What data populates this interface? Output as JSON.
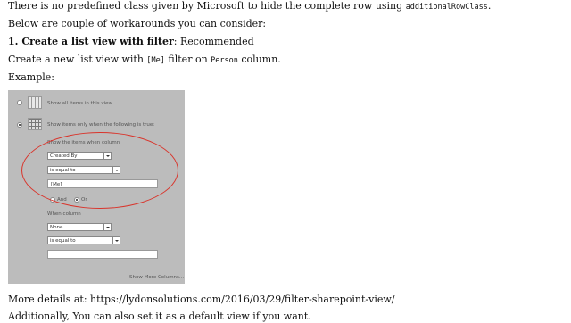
{
  "para1": {
    "text": "There is no predefined class given by Microsoft to hide the complete row using ",
    "code": "additionalRowClass",
    "end": "."
  },
  "para2": "Below are couple of workarounds you can consider:",
  "heading": {
    "bold": "1. Create a list view with filter",
    "rest": ": Recommended"
  },
  "para3": {
    "a": "Create a new list view with ",
    "code1": "[Me]",
    "b": " filter on ",
    "code2": "Person",
    "c": " column."
  },
  "example_label": "Example:",
  "screenshot": {
    "option_all": "Show all items in this view",
    "option_filtered": "Show items only when the following is true:",
    "show_when": "Show the items when column",
    "column1": "Created By",
    "operator1": "is equal to",
    "value1": "[Me]",
    "and_label": "And",
    "or_label": "Or",
    "when_column": "When column",
    "column2": "None",
    "operator2": "is equal to",
    "value2": "",
    "show_more": "Show More Columns...",
    "highlight_color": "#d9342b"
  },
  "more_details": "More details at: https://lydonsolutions.com/2016/03/29/filter-sharepoint-view/",
  "last_line": "Additionally, You can also set it as a default view if you want."
}
